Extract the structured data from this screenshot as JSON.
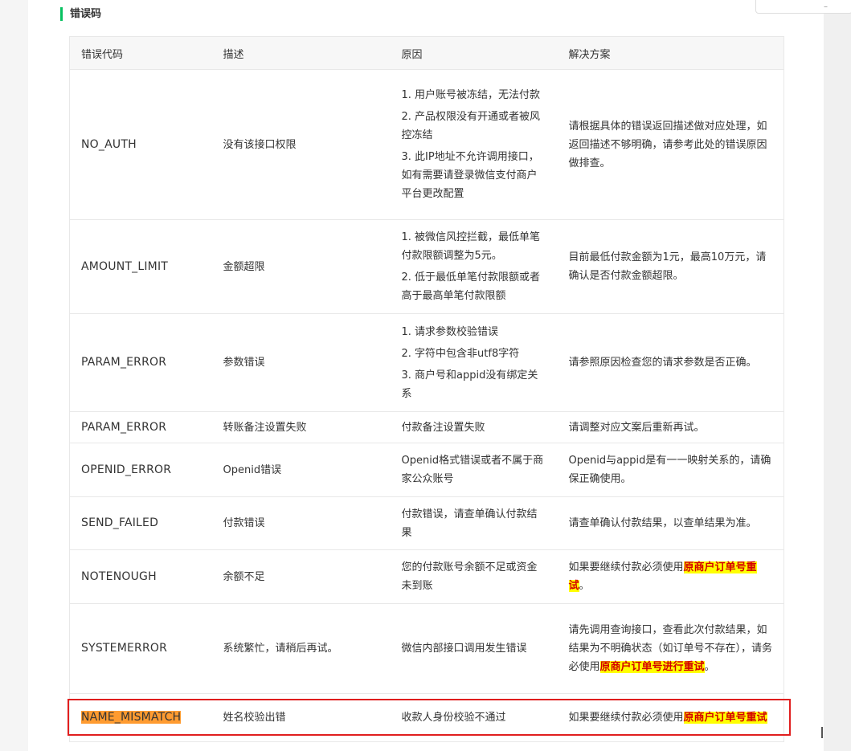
{
  "section": {
    "title": "错误码"
  },
  "table": {
    "headers": [
      "错误代码",
      "描述",
      "原因",
      "解决方案"
    ],
    "rows": [
      {
        "code": "NO_AUTH",
        "desc": "没有该接口权限",
        "reasons": [
          "1. 用户账号被冻结，无法付款",
          "2. 产品权限没有开通或者被风控冻结",
          "3. 此IP地址不允许调用接口，如有需要请登录微信支付商户平台更改配置"
        ],
        "solution": {
          "before": "请根据具体的错误返回描述做对应处理，如返回描述不够明确，请参考此处的错误原因做排查。"
        }
      },
      {
        "code": "AMOUNT_LIMIT",
        "desc": "金额超限",
        "reasons": [
          "1. 被微信风控拦截，最低单笔付款限额调整为5元。",
          "2. 低于最低单笔付款限额或者高于最高单笔付款限额"
        ],
        "solution": {
          "before": "目前最低付款金额为1元，最高10万元，请确认是否付款金额超限。"
        }
      },
      {
        "code": "PARAM_ERROR",
        "desc": "参数错误",
        "reasons": [
          "1. 请求参数校验错误",
          "2. 字符中包含非utf8字符",
          "3. 商户号和appid没有绑定关系"
        ],
        "solution": {
          "before": "请参照原因检查您的请求参数是否正确。"
        }
      },
      {
        "code": "PARAM_ERROR",
        "desc": "转账备注设置失败",
        "reasons": [
          "付款备注设置失败"
        ],
        "solution": {
          "before": "请调整对应文案后重新再试。"
        }
      },
      {
        "code": "OPENID_ERROR",
        "desc": "Openid错误",
        "reasons": [
          "Openid格式错误或者不属于商家公众账号"
        ],
        "solution": {
          "before": "Openid与appid是有一一映射关系的，请确保正确使用。"
        }
      },
      {
        "code": "SEND_FAILED",
        "desc": "付款错误",
        "reasons": [
          "付款错误，请查单确认付款结果"
        ],
        "solution": {
          "before": "请查单确认付款结果，以查单结果为准。"
        }
      },
      {
        "code": "NOTENOUGH",
        "desc": "余额不足",
        "reasons": [
          "您的付款账号余额不足或资金未到账"
        ],
        "solution": {
          "before": "如果要继续付款必须使用",
          "highlight": "原商户订单号重试",
          "after": "。"
        }
      },
      {
        "code": "SYSTEMERROR",
        "desc": "系统繁忙，请稍后再试。",
        "reasons": [
          "微信内部接口调用发生错误"
        ],
        "solution": {
          "before": "请先调用查询接口，查看此次付款结果，如结果为不明确状态（如订单号不存在），请务必使用",
          "highlight": "原商户订单号进行重试",
          "after": "。"
        }
      },
      {
        "code": "NAME_MISMATCH",
        "desc": "姓名校验出错",
        "reasons": [
          "收款人身份校验不通过"
        ],
        "solution": {
          "before": "如果要继续付款必须使用",
          "highlight": "原商户订单号重试",
          "after": ""
        },
        "selected": true
      }
    ]
  }
}
